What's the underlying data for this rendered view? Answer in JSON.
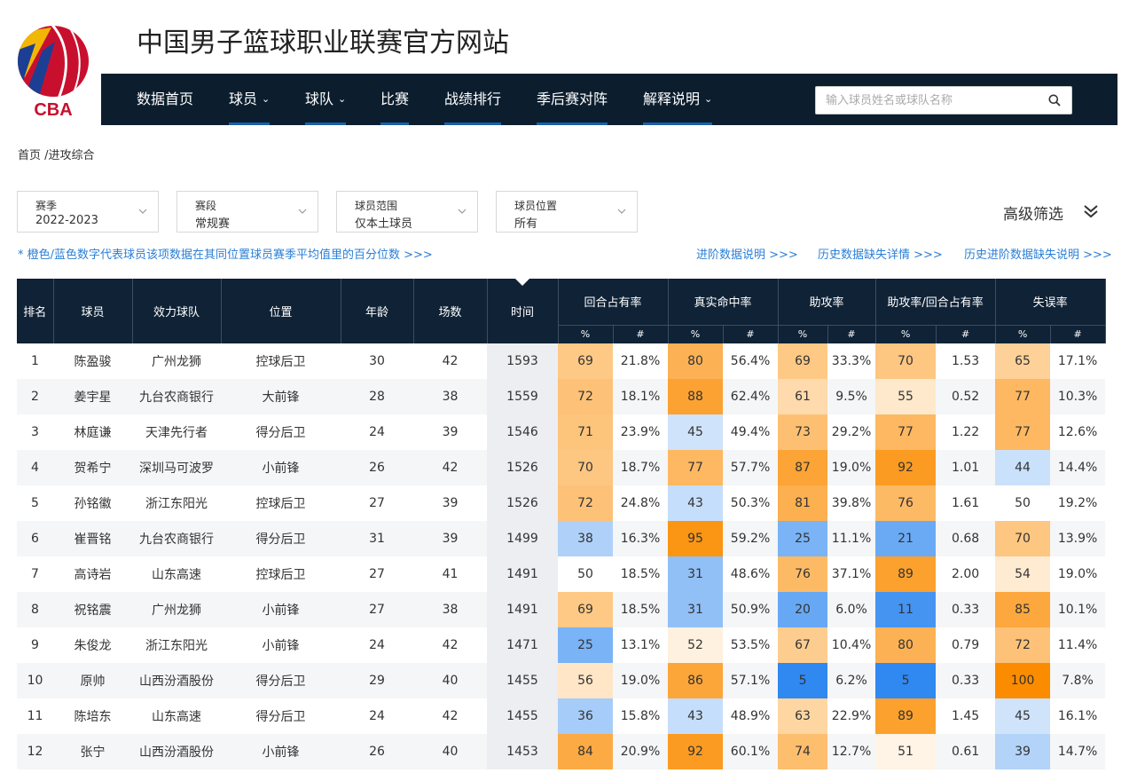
{
  "site": {
    "logo_text": "CBA",
    "title": "中国男子篮球职业联赛官方网站"
  },
  "nav": {
    "items": [
      {
        "label": "数据首页",
        "dropdown": false
      },
      {
        "label": "球员",
        "dropdown": true
      },
      {
        "label": "球队",
        "dropdown": true
      },
      {
        "label": "比赛",
        "dropdown": false
      },
      {
        "label": "战绩排行",
        "dropdown": false
      },
      {
        "label": "季后赛对阵",
        "dropdown": false
      },
      {
        "label": "解释说明",
        "dropdown": true
      }
    ],
    "search_placeholder": "输入球员姓名或球队名称",
    "search_value": ""
  },
  "breadcrumb": "首页 /进攻综合",
  "filters": [
    {
      "label": "赛季",
      "value": "2022-2023"
    },
    {
      "label": "赛段",
      "value": "常规赛"
    },
    {
      "label": "球员范围",
      "value": "仅本土球员"
    },
    {
      "label": "球员位置",
      "value": "所有"
    }
  ],
  "advanced_filter_label": "高级筛选",
  "note": "* 橙色/蓝色数字代表球员该项数据在其同位置球员赛季平均值里的百分位数 >>>",
  "links": [
    "进阶数据说明 >>>",
    "历史数据缺失详情 >>>",
    "历史进阶数据缺失说明 >>>"
  ],
  "colors": {
    "nav_bg": "#0c1e2e",
    "header_bg": "#0f2236",
    "link": "#2b7fd6",
    "accent_underline": "#1a5fa8",
    "orange_strong": "#fb8c00",
    "blue_strong": "#1e7ef0"
  },
  "table": {
    "columns": [
      "排名",
      "球员",
      "效力球队",
      "位置",
      "年龄",
      "场数",
      "时间"
    ],
    "groups": [
      "回合占有率",
      "真实命中率",
      "助攻率",
      "助攻率/回合占有率",
      "失误率"
    ],
    "sub_pct": "%",
    "sub_val": "#",
    "rows": [
      {
        "rank": "1",
        "player": "陈盈骏",
        "team": "广州龙狮",
        "pos": "控球后卫",
        "age": "30",
        "games": "42",
        "time": "1593",
        "stats": [
          [
            "69",
            "21.8%"
          ],
          [
            "80",
            "56.4%"
          ],
          [
            "69",
            "33.3%"
          ],
          [
            "70",
            "1.53"
          ],
          [
            "65",
            "17.1%"
          ]
        ]
      },
      {
        "rank": "2",
        "player": "姜宇星",
        "team": "九台农商银行",
        "pos": "大前锋",
        "age": "28",
        "games": "38",
        "time": "1559",
        "stats": [
          [
            "72",
            "18.1%"
          ],
          [
            "88",
            "62.4%"
          ],
          [
            "61",
            "9.5%"
          ],
          [
            "55",
            "0.52"
          ],
          [
            "77",
            "10.3%"
          ]
        ]
      },
      {
        "rank": "3",
        "player": "林庭谦",
        "team": "天津先行者",
        "pos": "得分后卫",
        "age": "24",
        "games": "39",
        "time": "1546",
        "stats": [
          [
            "71",
            "23.9%"
          ],
          [
            "45",
            "49.4%"
          ],
          [
            "73",
            "29.2%"
          ],
          [
            "77",
            "1.22"
          ],
          [
            "77",
            "12.6%"
          ]
        ]
      },
      {
        "rank": "4",
        "player": "贺希宁",
        "team": "深圳马可波罗",
        "pos": "小前锋",
        "age": "26",
        "games": "42",
        "time": "1526",
        "stats": [
          [
            "70",
            "18.7%"
          ],
          [
            "77",
            "57.7%"
          ],
          [
            "87",
            "19.0%"
          ],
          [
            "92",
            "1.01"
          ],
          [
            "44",
            "14.4%"
          ]
        ]
      },
      {
        "rank": "5",
        "player": "孙铭徽",
        "team": "浙江东阳光",
        "pos": "控球后卫",
        "age": "27",
        "games": "39",
        "time": "1526",
        "stats": [
          [
            "72",
            "24.8%"
          ],
          [
            "43",
            "50.3%"
          ],
          [
            "81",
            "39.8%"
          ],
          [
            "76",
            "1.61"
          ],
          [
            "50",
            "19.2%"
          ]
        ]
      },
      {
        "rank": "6",
        "player": "崔晋铭",
        "team": "九台农商银行",
        "pos": "得分后卫",
        "age": "31",
        "games": "39",
        "time": "1499",
        "stats": [
          [
            "38",
            "16.3%"
          ],
          [
            "95",
            "59.2%"
          ],
          [
            "25",
            "11.1%"
          ],
          [
            "21",
            "0.68"
          ],
          [
            "70",
            "13.9%"
          ]
        ]
      },
      {
        "rank": "7",
        "player": "高诗岩",
        "team": "山东高速",
        "pos": "控球后卫",
        "age": "27",
        "games": "41",
        "time": "1491",
        "stats": [
          [
            "50",
            "18.5%"
          ],
          [
            "31",
            "48.6%"
          ],
          [
            "76",
            "37.1%"
          ],
          [
            "89",
            "2.00"
          ],
          [
            "54",
            "19.0%"
          ]
        ]
      },
      {
        "rank": "8",
        "player": "祝铭震",
        "team": "广州龙狮",
        "pos": "小前锋",
        "age": "27",
        "games": "38",
        "time": "1491",
        "stats": [
          [
            "69",
            "18.5%"
          ],
          [
            "31",
            "50.9%"
          ],
          [
            "20",
            "6.0%"
          ],
          [
            "11",
            "0.33"
          ],
          [
            "85",
            "10.1%"
          ]
        ]
      },
      {
        "rank": "9",
        "player": "朱俊龙",
        "team": "浙江东阳光",
        "pos": "小前锋",
        "age": "24",
        "games": "42",
        "time": "1471",
        "stats": [
          [
            "25",
            "13.1%"
          ],
          [
            "52",
            "53.5%"
          ],
          [
            "67",
            "10.4%"
          ],
          [
            "80",
            "0.79"
          ],
          [
            "72",
            "11.4%"
          ]
        ]
      },
      {
        "rank": "10",
        "player": "原帅",
        "team": "山西汾酒股份",
        "pos": "得分后卫",
        "age": "29",
        "games": "40",
        "time": "1455",
        "stats": [
          [
            "56",
            "19.0%"
          ],
          [
            "86",
            "57.1%"
          ],
          [
            "5",
            "6.2%"
          ],
          [
            "5",
            "0.33"
          ],
          [
            "100",
            "7.8%"
          ]
        ]
      },
      {
        "rank": "11",
        "player": "陈培东",
        "team": "山东高速",
        "pos": "得分后卫",
        "age": "24",
        "games": "42",
        "time": "1455",
        "stats": [
          [
            "36",
            "15.8%"
          ],
          [
            "43",
            "48.9%"
          ],
          [
            "63",
            "22.9%"
          ],
          [
            "89",
            "1.45"
          ],
          [
            "45",
            "16.1%"
          ]
        ]
      },
      {
        "rank": "12",
        "player": "张宁",
        "team": "山西汾酒股份",
        "pos": "小前锋",
        "age": "26",
        "games": "40",
        "time": "1453",
        "stats": [
          [
            "84",
            "20.9%"
          ],
          [
            "92",
            "60.1%"
          ],
          [
            "74",
            "12.7%"
          ],
          [
            "51",
            "0.61"
          ],
          [
            "39",
            "14.7%"
          ]
        ]
      }
    ]
  }
}
